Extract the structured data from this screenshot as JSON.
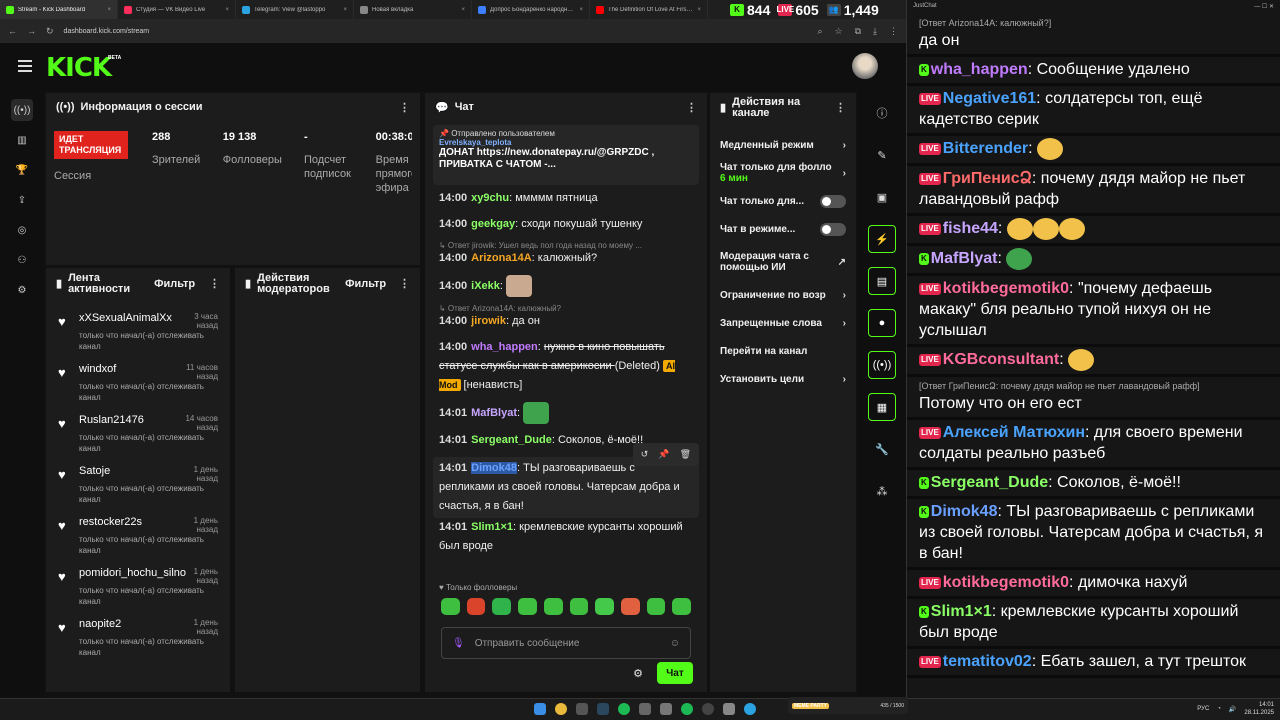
{
  "browser": {
    "tabs": [
      {
        "label": "Stream - Kick Dashboard",
        "color": "#53fc18",
        "active": true
      },
      {
        "label": "Студия — VK Видео Live",
        "color": "#ff2e5b"
      },
      {
        "label": "Telegram: View @lastoppo",
        "color": "#2aa3e0"
      },
      {
        "label": "Новая вкладка",
        "color": "#888888"
      },
      {
        "label": "Допрос Бондаренко народн…",
        "color": "#3d7fff"
      },
      {
        "label": "The Definition Of Love At First…",
        "color": "#ff0000"
      }
    ],
    "url": "dashboard.kick.com/stream"
  },
  "counters": [
    {
      "icon": "K",
      "value": "844",
      "color": "#53fc18"
    },
    {
      "icon": "LIVE",
      "value": "605",
      "color": "#e2264d"
    },
    {
      "icon": "👥",
      "value": "1,449",
      "color": "#444444"
    }
  ],
  "kick": {
    "logo": "KICK",
    "beta": "BETA"
  },
  "session": {
    "title": "Информация о сессии",
    "live_badge": "ИДЕТ ТРАНСЛЯЦИЯ",
    "session_label": "Сессия",
    "stats": [
      {
        "value": "288",
        "label": "Зрителей"
      },
      {
        "value": "19 138",
        "label": "Фолловеры"
      },
      {
        "value": "-",
        "label": "Подсчет подписок"
      },
      {
        "value": "00:38:0",
        "label": "Время прямого эфира"
      }
    ]
  },
  "feed": {
    "title": "Лента активности",
    "filter": "Фильтр",
    "items": [
      {
        "name": "xXSexualAnimalXx",
        "time": "3 часа назад",
        "sub": "только что начал(-а) отслеживать канал"
      },
      {
        "name": "windxof",
        "time": "11 часов назад",
        "sub": "только что начал(-а) отслеживать канал"
      },
      {
        "name": "Ruslan21476",
        "time": "14 часов назад",
        "sub": "только что начал(-а) отслеживать канал"
      },
      {
        "name": "Satoje",
        "time": "1 день назад",
        "sub": "только что начал(-а) отслеживать канал"
      },
      {
        "name": "restocker22s",
        "time": "1 день назад",
        "sub": "только что начал(-а) отслеживать канал"
      },
      {
        "name": "pomidori_hochu_silno",
        "time": "1 день назад",
        "sub": "только что начал(-а) отслеживать канал"
      },
      {
        "name": "naopite2",
        "time": "1 день назад",
        "sub": "только что начал(-а) отслеживать канал"
      }
    ]
  },
  "modactions": {
    "title": "Действия модераторов",
    "filter": "Фильтр"
  },
  "chat": {
    "title": "Чат",
    "pinned": {
      "title": "Отправлено пользователем",
      "user": "Evrelskaya_teplota",
      "text": "ДОНАТ https://new.donatepay.ru/@GRPZDC , ПРИВАТКА С ЧАТОМ -..."
    },
    "messages": [
      {
        "time": "14:00",
        "name": "xy9chu",
        "color": "#8bff66",
        "text": "ммммм пятница"
      },
      {
        "time": "14:00",
        "name": "geekgay",
        "color": "#8bff66",
        "text": "сходи покушай тушенку"
      },
      {
        "reply": "Ответ jirowik: Ушел ведь пол года назад по моему ...",
        "time": "14:00",
        "name": "Arizona14A",
        "color": "#f5a623",
        "text": "калюжный?"
      },
      {
        "time": "14:00",
        "name": "iXekk",
        "color": "#8bff66",
        "text": ""
      },
      {
        "reply": "Ответ Arizona14A: калюжный?",
        "time": "14:00",
        "name": "jirowik",
        "color": "#f5a623",
        "text": "да он"
      },
      {
        "time": "14:00",
        "name": "wha_happen",
        "color": "#c07bff",
        "text": "нужно в кино повышать статусе службы как в америкосии",
        "deleted": "(Deleted)",
        "badge": "AI Mod",
        "tag": "[ненависть]"
      },
      {
        "time": "14:01",
        "name": "MafBlyat",
        "color": "#c7a6ff",
        "text": ""
      },
      {
        "time": "14:01",
        "name": "Sergeant_Dude",
        "color": "#8bff66",
        "text": "Соколов, ё-моё!!"
      },
      {
        "time": "14:01",
        "name": "Dimok48",
        "color": "#6aa0ff",
        "text": "ТЫ разговариваешь с репликами из своей головы. Чатерсам добра и счастья, я в бан!"
      },
      {
        "time": "14:01",
        "name": "Slim1×1",
        "color": "#8bff66",
        "text": "кремлевские курсанты хороший был вроде"
      }
    ],
    "followers_only": "Только фолловеры",
    "placeholder": "Отправить сообщение",
    "send": "Чат"
  },
  "actions": {
    "title": "Действия на канале",
    "items": [
      {
        "label": "Медленный режим",
        "kind": "chev"
      },
      {
        "label": "Чат только для фолло",
        "sub": "6 мин",
        "kind": "chev"
      },
      {
        "label": "Чат только для...",
        "kind": "toggle"
      },
      {
        "label": "Чат в режиме...",
        "kind": "toggle"
      },
      {
        "label": "Модерация чата с помощью ИИ",
        "kind": "ext"
      },
      {
        "label": "Ограничение по возр",
        "kind": "chev"
      },
      {
        "label": "Запрещенные слова",
        "kind": "chev"
      },
      {
        "label": "Перейти на канал",
        "kind": "none"
      },
      {
        "label": "Установить цели",
        "kind": "chev"
      }
    ]
  },
  "overlay": {
    "title": "JustChat",
    "messages": [
      {
        "reply": "[Ответ Arizona14A: калюжный?]",
        "text": "да он"
      },
      {
        "pl": "k",
        "name": "wha_happen",
        "color": "#c07bff",
        "text": "Сообщение удалено"
      },
      {
        "pl": "v",
        "name": "Negative161",
        "color": "#4aa3ff",
        "text": "солдатерсы топ, ещё кадетство серик"
      },
      {
        "pl": "v",
        "name": "Bitterender",
        "color": "#4aa3ff",
        "text": ""
      },
      {
        "pl": "v",
        "name": "ГриПенисՁ",
        "color": "#ff6b6b",
        "text": "почему дядя майор не пьет лавандовый рафф"
      },
      {
        "pl": "v",
        "name": "fishe44",
        "color": "#c7a6ff",
        "text": ""
      },
      {
        "pl": "k",
        "name": "MafBlyat",
        "color": "#c7a6ff",
        "text": ""
      },
      {
        "pl": "v",
        "name": "kotikbegemotik0",
        "color": "#ff6b9a",
        "text": "\"почему дефаешь макаку\" бля реально тупой нихуя он не услышал"
      },
      {
        "pl": "v",
        "name": "KGBconsultant",
        "color": "#ff6b9a",
        "text": ""
      },
      {
        "reply": "[Ответ ГриПенисՁ: почему дядя майор не пьет лавандовый рафф]",
        "text": "Потому что он его ест"
      },
      {
        "pl": "v",
        "name": "Алексей Матюхин",
        "color": "#4aa3ff",
        "text": "для своего времени солдаты реально разъеб"
      },
      {
        "pl": "k",
        "name": "Sergeant_Dude",
        "color": "#8bff66",
        "text": "Соколов, ё-моё!!"
      },
      {
        "pl": "k",
        "name": "Dimok48",
        "color": "#6aa0ff",
        "text": "ТЫ разговариваешь с репликами из своей головы. Чатерсам добра и счастья, я в бан!"
      },
      {
        "pl": "v",
        "name": "kotikbegemotik0",
        "color": "#ff6b9a",
        "text": "димочка нахуй"
      },
      {
        "pl": "k",
        "name": "Slim1×1",
        "color": "#8bff66",
        "text": "кремлевские курсанты хороший был вроде"
      },
      {
        "pl": "v",
        "name": "tematitov02",
        "color": "#4aa3ff",
        "text": "Ебать зашел, а тут трешток"
      }
    ]
  },
  "taskbar": {
    "meme": "MEME PARTY",
    "meme_count": "435 / 1500",
    "lang": "РУС",
    "time": "14:01",
    "date": "28.11.2025"
  }
}
